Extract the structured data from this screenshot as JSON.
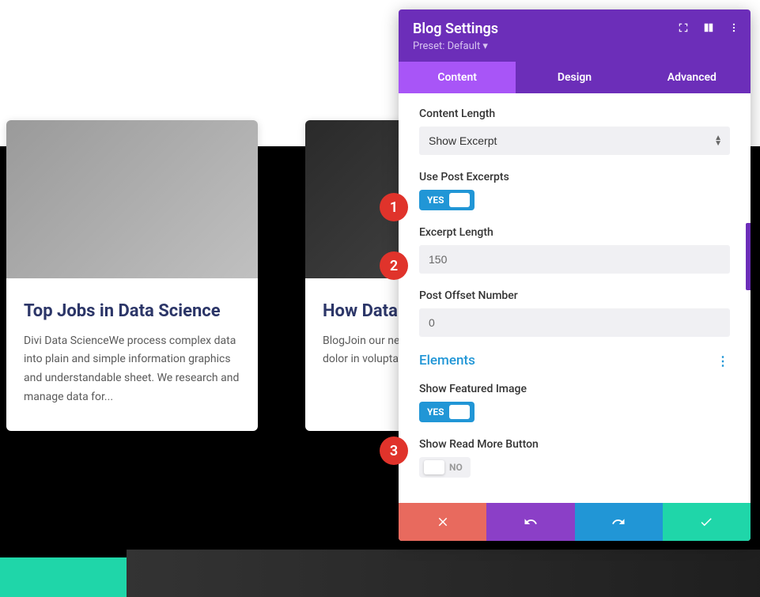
{
  "cards": [
    {
      "title": "Top Jobs in Data Science",
      "text": "Divi Data ScienceWe process complex data into plain and simple information graphics and understandable sheet. We research and manage data for..."
    },
    {
      "title": "How Data Science Works",
      "text": "BlogJoin our newsletter DiviDuis aute irure dolor in voluptate velit esse cillum nulla..."
    }
  ],
  "panel": {
    "title": "Blog Settings",
    "preset": "Preset: Default ▾",
    "tabs": {
      "content": "Content",
      "design": "Design",
      "advanced": "Advanced"
    }
  },
  "fields": {
    "content_length": {
      "label": "Content Length",
      "value": "Show Excerpt"
    },
    "use_excerpts": {
      "label": "Use Post Excerpts",
      "state": "YES"
    },
    "excerpt_length": {
      "label": "Excerpt Length",
      "value": "150"
    },
    "post_offset": {
      "label": "Post Offset Number",
      "value": "0"
    },
    "elements_title": "Elements",
    "show_featured": {
      "label": "Show Featured Image",
      "state": "YES"
    },
    "show_readmore": {
      "label": "Show Read More Button",
      "state": "NO"
    }
  },
  "badges": {
    "one": "1",
    "two": "2",
    "three": "3"
  }
}
